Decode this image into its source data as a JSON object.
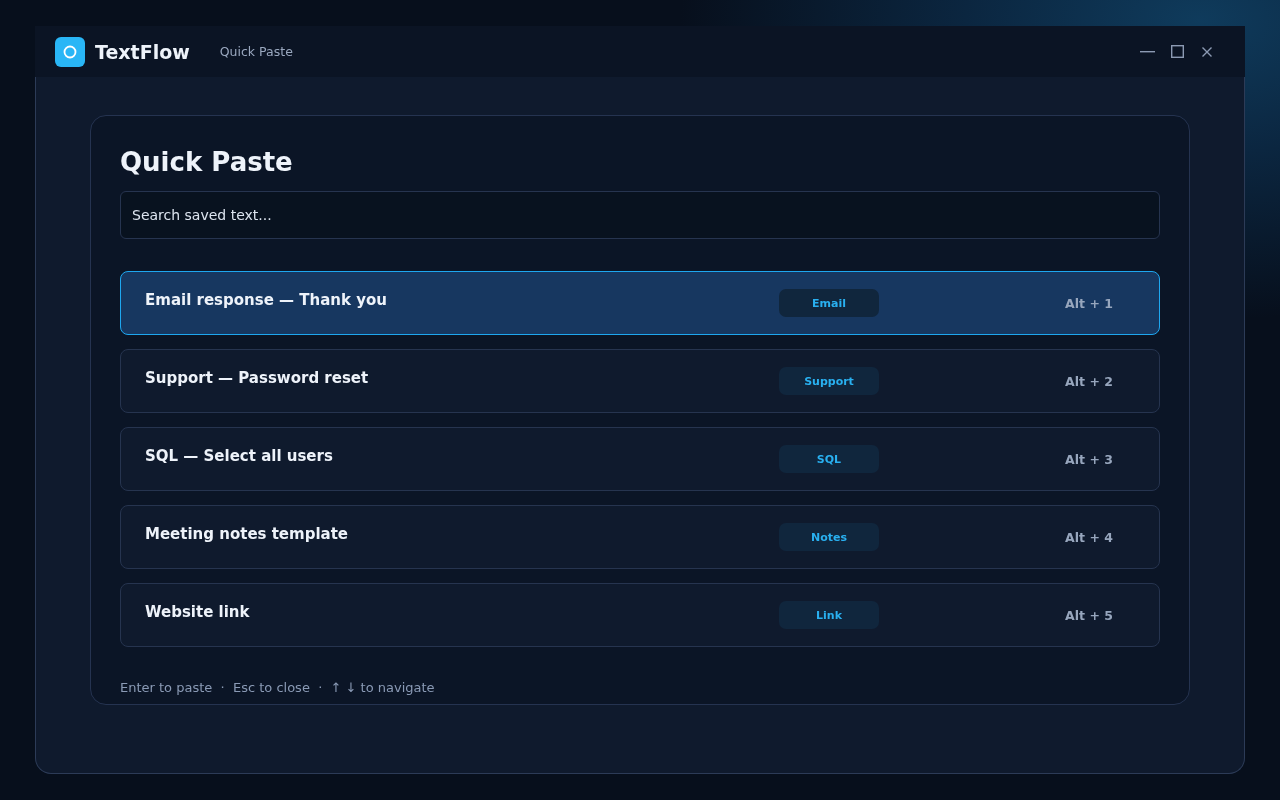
{
  "window": {
    "app_name": "TextFlow",
    "subtitle": "Quick Paste"
  },
  "panel": {
    "title": "Quick Paste",
    "search": {
      "placeholder": "Search saved text..."
    },
    "items": [
      {
        "title": "Email response — Thank you",
        "tag": "Email",
        "shortcut": "Alt + 1",
        "selected": true
      },
      {
        "title": "Support — Password reset",
        "tag": "Support",
        "shortcut": "Alt + 2",
        "selected": false
      },
      {
        "title": "SQL — Select all users",
        "tag": "SQL",
        "shortcut": "Alt + 3",
        "selected": false
      },
      {
        "title": "Meeting notes template",
        "tag": "Notes",
        "shortcut": "Alt + 4",
        "selected": false
      },
      {
        "title": "Website link",
        "tag": "Link",
        "shortcut": "Alt + 5",
        "selected": false
      }
    ],
    "footer_hint": "Enter to paste  ·  Esc to close  ·  ↑ ↓ to navigate"
  }
}
